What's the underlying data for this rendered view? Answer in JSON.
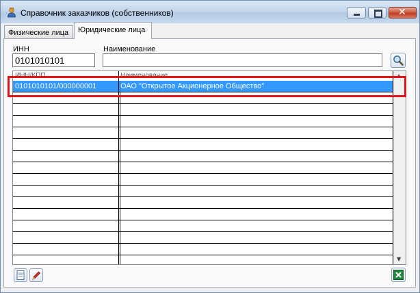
{
  "window": {
    "title": "Справочник заказчиков (собственников)",
    "icons": {
      "app": "user-icon",
      "minimize": "minimize-icon",
      "maximize": "maximize-icon",
      "close": "close-icon"
    }
  },
  "tabs": [
    {
      "label": "Физические лица",
      "active": false
    },
    {
      "label": "Юридические лица",
      "active": true
    }
  ],
  "filters": {
    "inn_label": "ИНН",
    "inn_value": "0101010101",
    "name_label": "Наименование",
    "name_value": "",
    "search_icon": "magnifier-icon"
  },
  "grid": {
    "columns": [
      "ИНН/КПП",
      "Наименование"
    ],
    "rows": [
      {
        "inn_kpp": "0101010101/000000001",
        "name": "ОАО \"Открытое Акционерное Общество\"",
        "selected": true
      }
    ],
    "empty_rows": 15
  },
  "toolbar": {
    "new_icon": "document-icon",
    "edit_icon": "pencil-icon",
    "export_icon": "excel-icon"
  },
  "colors": {
    "selection": "#3399ff",
    "highlight_border": "#e3141c",
    "close_button": "#c8553d"
  }
}
